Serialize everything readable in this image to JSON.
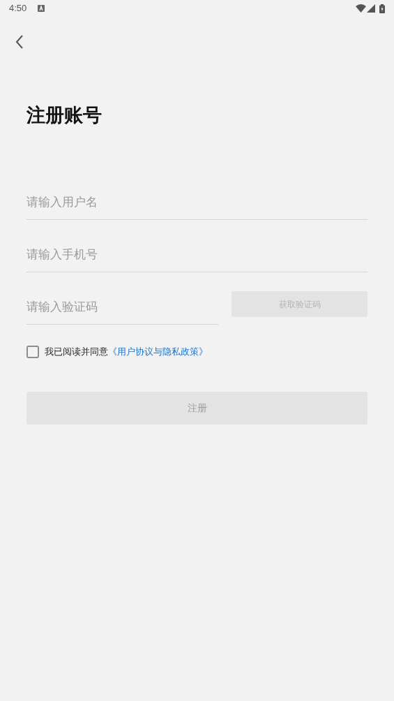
{
  "status_bar": {
    "time": "4:50"
  },
  "title": "注册账号",
  "fields": [
    {
      "placeholder": "请输入用户名"
    },
    {
      "placeholder": "请输入手机号"
    }
  ],
  "code_field": {
    "placeholder": "请输入验证码"
  },
  "code_button": {
    "label": "获取验证码",
    "disabled": true
  },
  "agreement": {
    "checked": false,
    "text": "我已阅读并同意",
    "link": "《用户协议与隐私政策》"
  },
  "register_button": {
    "label": "注册",
    "disabled": true
  }
}
